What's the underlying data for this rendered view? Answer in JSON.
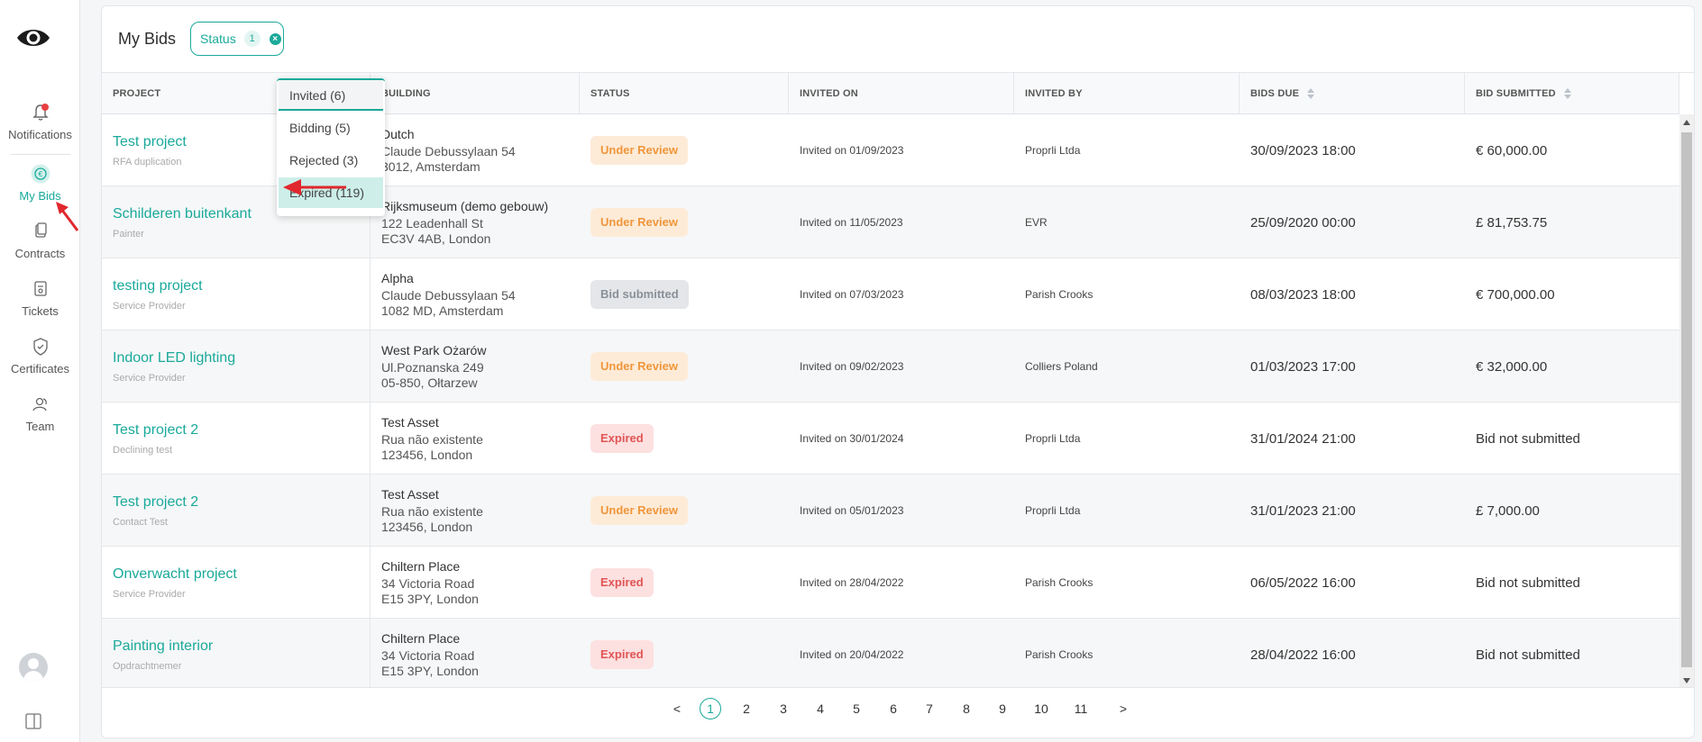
{
  "sidebar": {
    "items": [
      {
        "label": "Notifications",
        "icon": "bell-icon"
      },
      {
        "label": "My Bids",
        "icon": "euro-icon"
      },
      {
        "label": "Contracts",
        "icon": "contract-icon"
      },
      {
        "label": "Tickets",
        "icon": "ticket-icon"
      },
      {
        "label": "Certificates",
        "icon": "shield-check-icon"
      },
      {
        "label": "Team",
        "icon": "team-icon"
      }
    ]
  },
  "header": {
    "title": "My Bids",
    "filter_label": "Status",
    "filter_count": "1"
  },
  "dropdown": {
    "options": [
      "Invited (6)",
      "Bidding (5)",
      "Rejected (3)",
      "Expired (119)"
    ]
  },
  "table": {
    "columns": [
      "Project",
      "Building",
      "Status",
      "Invited on",
      "Invited by",
      "Bids due",
      "Bid submitted"
    ],
    "rows": [
      {
        "project": "Test project",
        "sub": "RFA duplication",
        "building": "Dutch",
        "addr1": "Claude Debussylaan 54",
        "addr2": "3012, Amsterdam",
        "status": "Under Review",
        "invited_on": "Invited on 01/09/2023",
        "invited_by": "Proprli Ltda",
        "due": "30/09/2023 18:00",
        "submitted": "€ 60,000.00"
      },
      {
        "project": "Schilderen buitenkant",
        "sub": "Painter",
        "building": "Rijksmuseum (demo gebouw)",
        "addr1": "122 Leadenhall St",
        "addr2": "EC3V 4AB, London",
        "status": "Under Review",
        "invited_on": "Invited on 11/05/2023",
        "invited_by": "EVR",
        "due": "25/09/2020 00:00",
        "submitted": "£ 81,753.75"
      },
      {
        "project": "testing project",
        "sub": "Service Provider",
        "building": "Alpha",
        "addr1": "Claude Debussylaan 54",
        "addr2": "1082 MD, Amsterdam",
        "status": "Bid submitted",
        "invited_on": "Invited on 07/03/2023",
        "invited_by": "Parish Crooks",
        "due": "08/03/2023 18:00",
        "submitted": "€ 700,000.00"
      },
      {
        "project": "Indoor LED lighting",
        "sub": "Service Provider",
        "building": "West Park Ożarów",
        "addr1": "Ul.Poznanska 249",
        "addr2": "05-850, Ołtarzew",
        "status": "Under Review",
        "invited_on": "Invited on 09/02/2023",
        "invited_by": "Colliers Poland",
        "due": "01/03/2023 17:00",
        "submitted": "€ 32,000.00"
      },
      {
        "project": "Test project 2",
        "sub": "Declining test",
        "building": "Test Asset",
        "addr1": "Rua não existente",
        "addr2": "123456, London",
        "status": "Expired",
        "invited_on": "Invited on 30/01/2024",
        "invited_by": "Proprli Ltda",
        "due": "31/01/2024 21:00",
        "submitted": "Bid not submitted"
      },
      {
        "project": "Test project 2",
        "sub": "Contact Test",
        "building": "Test Asset",
        "addr1": "Rua não existente",
        "addr2": "123456, London",
        "status": "Under Review",
        "invited_on": "Invited on 05/01/2023",
        "invited_by": "Proprli Ltda",
        "due": "31/01/2023 21:00",
        "submitted": "£ 7,000.00"
      },
      {
        "project": "Onverwacht project",
        "sub": "Service Provider",
        "building": "Chiltern Place",
        "addr1": "34 Victoria Road",
        "addr2": "E15 3PY, London",
        "status": "Expired",
        "invited_on": "Invited on 28/04/2022",
        "invited_by": "Parish Crooks",
        "due": "06/05/2022 16:00",
        "submitted": "Bid not submitted"
      },
      {
        "project": "Painting interior",
        "sub": "Opdrachtnemer",
        "building": "Chiltern Place",
        "addr1": "34 Victoria Road",
        "addr2": "E15 3PY, London",
        "status": "Expired",
        "invited_on": "Invited on 20/04/2022",
        "invited_by": "Parish Crooks",
        "due": "28/04/2022 16:00",
        "submitted": "Bid not submitted"
      }
    ]
  },
  "pagination": {
    "prev": "<",
    "next": ">",
    "pages": [
      "1",
      "2",
      "3",
      "4",
      "5",
      "6",
      "7",
      "8",
      "9",
      "10",
      "11"
    ],
    "current": "1"
  },
  "colors": {
    "accent": "#1aa99a",
    "annotation": "#e0282e"
  }
}
